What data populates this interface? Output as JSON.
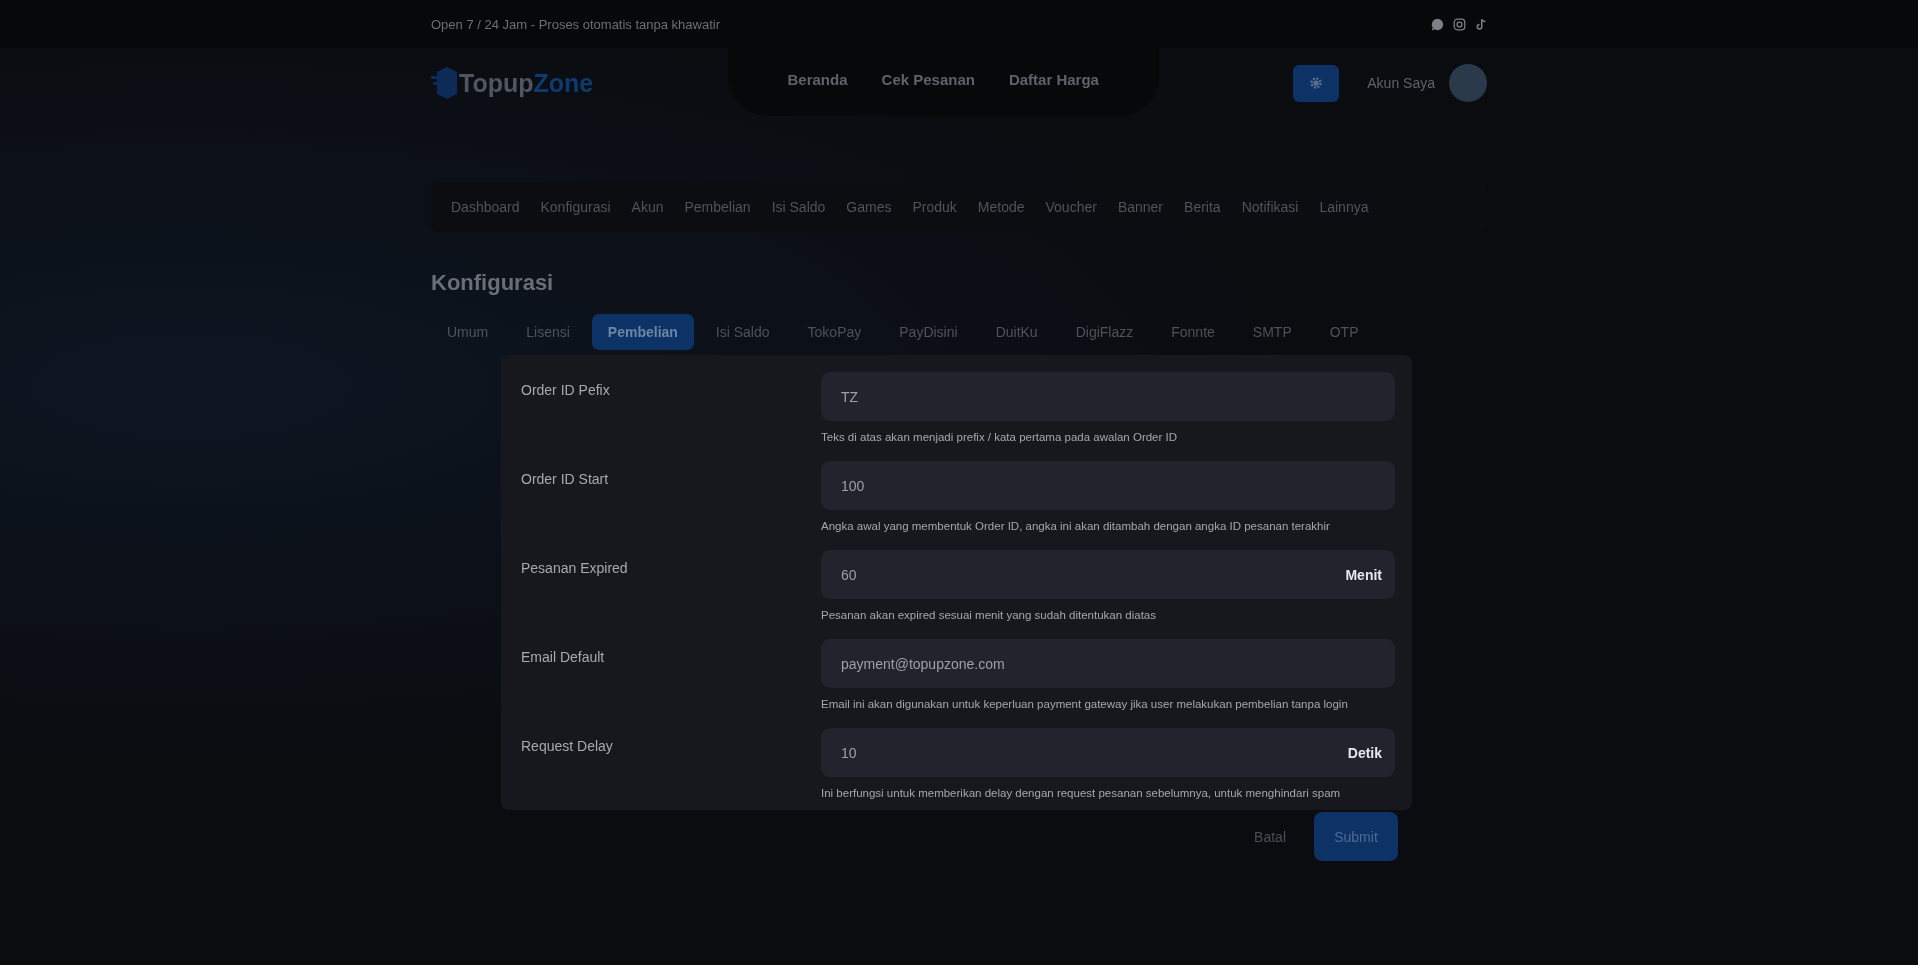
{
  "top_bar": {
    "text": "Open 7 / 24 Jam - Proses otomatis tanpa khawatir"
  },
  "header": {
    "logo": {
      "part_1": "Topup",
      "part_2": "Zone"
    },
    "nav": [
      {
        "label": "Beranda"
      },
      {
        "label": "Cek Pesanan"
      },
      {
        "label": "Daftar Harga"
      }
    ],
    "account": "Akun Saya"
  },
  "admin_menu": [
    {
      "label": "Dashboard"
    },
    {
      "label": "Konfigurasi"
    },
    {
      "label": "Akun"
    },
    {
      "label": "Pembelian"
    },
    {
      "label": "Isi Saldo"
    },
    {
      "label": "Games"
    },
    {
      "label": "Produk"
    },
    {
      "label": "Metode"
    },
    {
      "label": "Voucher"
    },
    {
      "label": "Banner"
    },
    {
      "label": "Berita"
    },
    {
      "label": "Notifikasi"
    },
    {
      "label": "Lainnya"
    }
  ],
  "page_title": "Konfigurasi",
  "tabs": [
    {
      "label": "Umum",
      "selected": false
    },
    {
      "label": "Lisensi",
      "selected": false
    },
    {
      "label": "Pembelian",
      "selected": true
    },
    {
      "label": "Isi Saldo",
      "selected": false
    },
    {
      "label": "TokoPay",
      "selected": false
    },
    {
      "label": "PayDisini",
      "selected": false
    },
    {
      "label": "DuitKu",
      "selected": false
    },
    {
      "label": "DigiFlazz",
      "selected": false
    },
    {
      "label": "Fonnte",
      "selected": false
    },
    {
      "label": "SMTP",
      "selected": false
    },
    {
      "label": "OTP",
      "selected": false
    }
  ],
  "fields": [
    {
      "label": "Order ID Pefix",
      "value": "TZ",
      "help": "Teks di atas akan menjadi prefix / kata pertama pada awalan Order ID"
    },
    {
      "label": "Order ID Start",
      "value": "100",
      "help": "Angka awal yang membentuk Order ID, angka ini akan ditambah dengan angka ID pesanan terakhir"
    },
    {
      "label": "Pesanan Expired",
      "value": "60",
      "suffix": "Menit",
      "help": "Pesanan akan expired sesuai menit yang sudah ditentukan diatas"
    },
    {
      "label": "Email Default",
      "value": "payment@topupzone.com",
      "help": "Email ini akan digunakan untuk keperluan payment gateway jika user melakukan pembelian tanpa login"
    },
    {
      "label": "Request Delay",
      "value": "10",
      "suffix": "Detik",
      "help": "Ini berfungsi untuk memberikan delay dengan request pesanan sebelumnya, untuk menghindari spam"
    }
  ],
  "buttons": {
    "cancel": "Batal",
    "submit": "Submit"
  }
}
